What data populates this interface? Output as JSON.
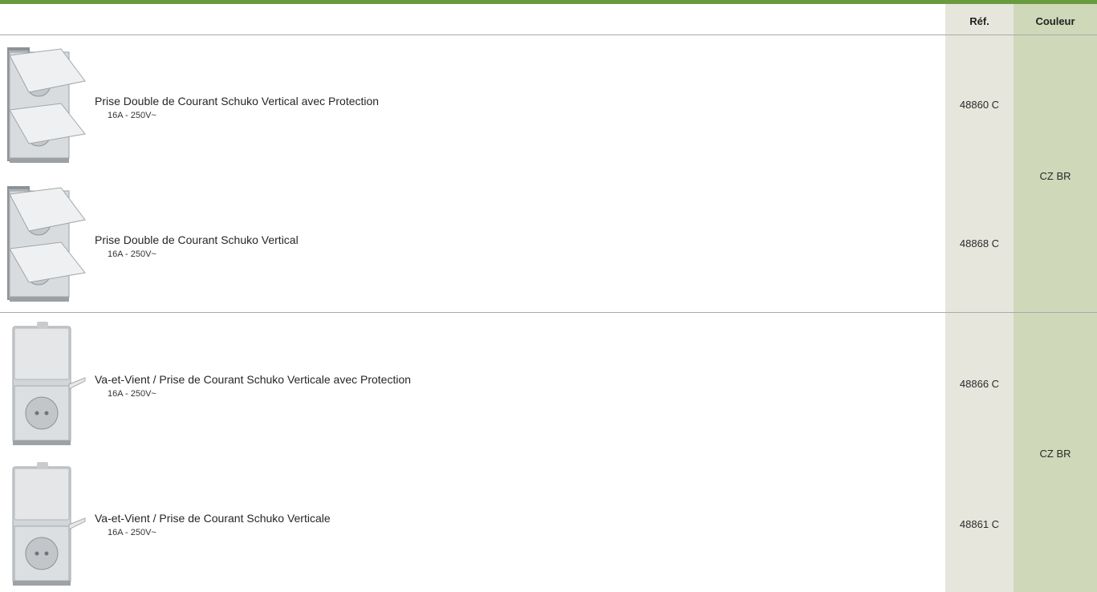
{
  "table": {
    "headers": {
      "ref": "Réf.",
      "couleur": "Couleur"
    },
    "groups": [
      {
        "couleur": "CZ BR",
        "items": [
          {
            "name": "Prise Double de Courant Schuko Vertical avec Protection",
            "spec": "16A - 250V~",
            "ref": "48860 C",
            "icon": "double-schuko-socket-icon"
          },
          {
            "name": "Prise Double de Courant Schuko Vertical",
            "spec": "16A - 250V~",
            "ref": "48868 C",
            "icon": "double-schuko-socket-icon"
          }
        ]
      },
      {
        "couleur": "CZ BR",
        "items": [
          {
            "name": "Va-et-Vient / Prise de Courant Schuko Verticale avec Protection",
            "spec": "16A - 250V~",
            "ref": "48866 C",
            "icon": "switch-socket-combo-icon"
          },
          {
            "name": "Va-et-Vient / Prise de Courant Schuko Verticale",
            "spec": "16A - 250V~",
            "ref": "48861 C",
            "icon": "switch-socket-combo-icon"
          }
        ]
      }
    ]
  },
  "colors": {
    "accent_bar": "#6a9a3e",
    "ref_column": "#e6e6dc",
    "color_column": "#cfd8b8"
  }
}
